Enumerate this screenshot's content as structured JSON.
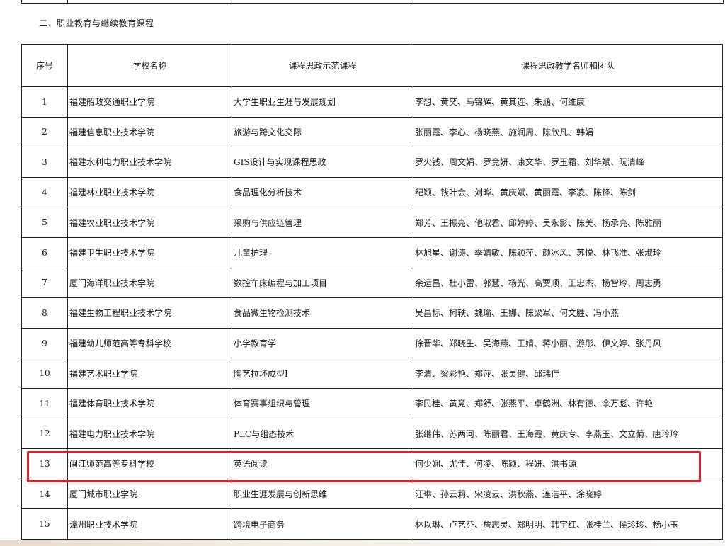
{
  "section": {
    "heading": "二、职业教育与继续教育课程"
  },
  "table": {
    "headers": [
      "序号",
      "学校名称",
      "课程思政示范课程",
      "课程思政教学名师和团队"
    ],
    "rows": [
      {
        "idx": "1",
        "school": "福建船政交通职业学院",
        "course": "大学生职业生涯与发展规划",
        "team": "李想、黄奕、马锦辉、黄其连、朱涵、何维康"
      },
      {
        "idx": "2",
        "school": "福建信息职业技术学院",
        "course": "旅游与跨文化交际",
        "team": "张丽霞、李心、杨晓燕、施润周、陈欣凡、韩娟"
      },
      {
        "idx": "3",
        "school": "福建水利电力职业技术学院",
        "course": "GIS设计与实现课程思政",
        "team": "罗火钱、周文娟、罗竟妍、康文华、罗玉霜、刘华斌、阮清峰"
      },
      {
        "idx": "4",
        "school": "福建林业职业技术学院",
        "course": "食品理化分析技术",
        "team": "纪颖、钱叶会、刘晔、黄庆斌、黄丽霞、李凌、陈锋、陈剑"
      },
      {
        "idx": "5",
        "school": "福建农业职业技术学院",
        "course": "采购与供应链管理",
        "team": "郑芳、王振亮、他淑君、邱婷婷、吴永影、陈美、杨承亮、陈雅丽"
      },
      {
        "idx": "6",
        "school": "福建卫生职业技术学院",
        "course": "儿童护理",
        "team": "林旭星、谢涛、季婧敏、陈颖萍、颜冰风、苏悦、林飞准、张淑玲"
      },
      {
        "idx": "7",
        "school": "厦门海洋职业技术学院",
        "course": "数控车床编程与加工项目",
        "team": "余运昌、杜小雷、郭慧、杨光、高贾顺、王忠杰、杨智玲、周志勇"
      },
      {
        "idx": "8",
        "school": "福建生物工程职业技术学院",
        "course": "食品微生物检测技术",
        "team": "吴昌标、柯轶、魏瑜、王娜、陈梁军、何文胜、冯小燕"
      },
      {
        "idx": "9",
        "school": "福建幼儿师范高等专科学校",
        "course": "小学教育学",
        "team": "徐晋华、郑晓生、吴海燕、王婧、蒋小丽、游彤、伊文婷、张丹风"
      },
      {
        "idx": "10",
        "school": "福建艺术职业学院",
        "course": "陶艺拉坯成型I",
        "team": "李清、梁彩艳、郑萍、张灵健、邱玮佳"
      },
      {
        "idx": "11",
        "school": "福建体育职业技术学院",
        "course": "体育赛事组织与管理",
        "team": "李民桂、黄竞、郑舒、张燕平、卓鹤洲、林有德、余万彪、许艳"
      },
      {
        "idx": "12",
        "school": "福建电力职业技术学院",
        "course": "PLC与组态技术",
        "team": "张继伟、苏两河、陈丽君、王海霞、黄庆专、李燕玉、文立菊、唐玲玲"
      },
      {
        "idx": "13",
        "school": "闽江师范高等专科学校",
        "course": "英语阅读",
        "team": "何少娴、尤佳、何凌、陈颖、程妍、洪书源"
      },
      {
        "idx": "14",
        "school": "厦门城市职业学院",
        "course": "职业生涯发展与创新思维",
        "team": "汪琳、孙云莉、宋凌云、洪秋燕、连洁平、涂晓婷"
      },
      {
        "idx": "15",
        "school": "漳州职业技术学院",
        "course": "跨境电子商务",
        "team": "林以琳、卢艺芬、詹志灵、郑明明、韩宇红、张桂兰、侯珍珍、杨小玉"
      }
    ]
  },
  "highlight": {
    "row": "13",
    "color": "#e0202a"
  }
}
